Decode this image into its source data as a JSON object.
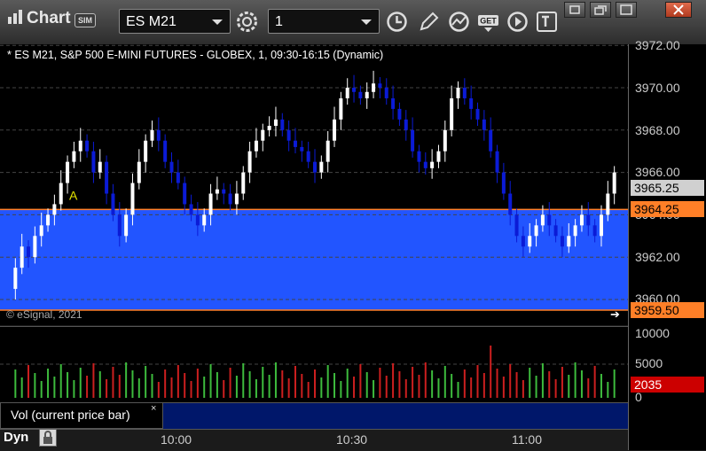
{
  "toolbar": {
    "title": "Chart",
    "sim_badge": "SIM",
    "symbol": "ES M21",
    "interval": "1",
    "icons": [
      "chart-logo-icon",
      "settings-gear-icon",
      "clock-icon",
      "pencil-draw-icon",
      "speedometer-icon",
      "get-data-icon",
      "play-icon",
      "text-cursor-icon"
    ],
    "window_icons": [
      "restore-icon",
      "restore-alt-icon",
      "maximize-icon",
      "close-icon"
    ]
  },
  "chart": {
    "header": "* ES M21, S&P 500 E-MINI FUTURES - GLOBEX, 1, 09:30-16:15 (Dynamic)",
    "copyright": "© eSignal, 2021",
    "marker_label": "A",
    "price_labels": [
      "3972.00",
      "3970.00",
      "3968.00",
      "3966.00",
      "3964.00",
      "3962.00",
      "3960.00"
    ],
    "price_tags": {
      "last_price": "3965.25",
      "upper_level": "3964.25",
      "lower_level": "3959.50"
    },
    "colors": {
      "up_candle": "#ffffff",
      "down_candle": "#0b1bd6",
      "zone_fill": "#2255ff",
      "level_line": "#ff7f27",
      "vol_up": "#3dbb3d",
      "vol_down": "#cc1f1f",
      "last_price_tag": "#d0d0d0",
      "volume_tag": "#cc0000"
    }
  },
  "volume": {
    "labels": [
      "10000",
      "5000",
      "0"
    ],
    "current": "2035",
    "study_name": "Vol (current price bar)",
    "close_glyph": "×"
  },
  "time_axis": {
    "labels": [
      "10:00",
      "10:30",
      "11:00"
    ]
  },
  "status": {
    "mode": "Dyn",
    "lock_icon": "lock-icon"
  }
}
